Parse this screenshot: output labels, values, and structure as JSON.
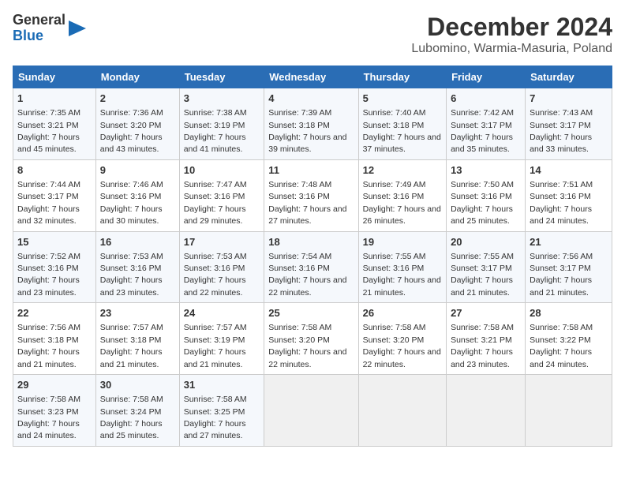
{
  "logo": {
    "line1": "General",
    "line2": "Blue"
  },
  "title": "December 2024",
  "subtitle": "Lubomino, Warmia-Masuria, Poland",
  "days_of_week": [
    "Sunday",
    "Monday",
    "Tuesday",
    "Wednesday",
    "Thursday",
    "Friday",
    "Saturday"
  ],
  "weeks": [
    [
      {
        "day": 1,
        "sunrise": "7:35 AM",
        "sunset": "3:21 PM",
        "daylight": "7 hours and 45 minutes."
      },
      {
        "day": 2,
        "sunrise": "7:36 AM",
        "sunset": "3:20 PM",
        "daylight": "7 hours and 43 minutes."
      },
      {
        "day": 3,
        "sunrise": "7:38 AM",
        "sunset": "3:19 PM",
        "daylight": "7 hours and 41 minutes."
      },
      {
        "day": 4,
        "sunrise": "7:39 AM",
        "sunset": "3:18 PM",
        "daylight": "7 hours and 39 minutes."
      },
      {
        "day": 5,
        "sunrise": "7:40 AM",
        "sunset": "3:18 PM",
        "daylight": "7 hours and 37 minutes."
      },
      {
        "day": 6,
        "sunrise": "7:42 AM",
        "sunset": "3:17 PM",
        "daylight": "7 hours and 35 minutes."
      },
      {
        "day": 7,
        "sunrise": "7:43 AM",
        "sunset": "3:17 PM",
        "daylight": "7 hours and 33 minutes."
      }
    ],
    [
      {
        "day": 8,
        "sunrise": "7:44 AM",
        "sunset": "3:17 PM",
        "daylight": "7 hours and 32 minutes."
      },
      {
        "day": 9,
        "sunrise": "7:46 AM",
        "sunset": "3:16 PM",
        "daylight": "7 hours and 30 minutes."
      },
      {
        "day": 10,
        "sunrise": "7:47 AM",
        "sunset": "3:16 PM",
        "daylight": "7 hours and 29 minutes."
      },
      {
        "day": 11,
        "sunrise": "7:48 AM",
        "sunset": "3:16 PM",
        "daylight": "7 hours and 27 minutes."
      },
      {
        "day": 12,
        "sunrise": "7:49 AM",
        "sunset": "3:16 PM",
        "daylight": "7 hours and 26 minutes."
      },
      {
        "day": 13,
        "sunrise": "7:50 AM",
        "sunset": "3:16 PM",
        "daylight": "7 hours and 25 minutes."
      },
      {
        "day": 14,
        "sunrise": "7:51 AM",
        "sunset": "3:16 PM",
        "daylight": "7 hours and 24 minutes."
      }
    ],
    [
      {
        "day": 15,
        "sunrise": "7:52 AM",
        "sunset": "3:16 PM",
        "daylight": "7 hours and 23 minutes."
      },
      {
        "day": 16,
        "sunrise": "7:53 AM",
        "sunset": "3:16 PM",
        "daylight": "7 hours and 23 minutes."
      },
      {
        "day": 17,
        "sunrise": "7:53 AM",
        "sunset": "3:16 PM",
        "daylight": "7 hours and 22 minutes."
      },
      {
        "day": 18,
        "sunrise": "7:54 AM",
        "sunset": "3:16 PM",
        "daylight": "7 hours and 22 minutes."
      },
      {
        "day": 19,
        "sunrise": "7:55 AM",
        "sunset": "3:16 PM",
        "daylight": "7 hours and 21 minutes."
      },
      {
        "day": 20,
        "sunrise": "7:55 AM",
        "sunset": "3:17 PM",
        "daylight": "7 hours and 21 minutes."
      },
      {
        "day": 21,
        "sunrise": "7:56 AM",
        "sunset": "3:17 PM",
        "daylight": "7 hours and 21 minutes."
      }
    ],
    [
      {
        "day": 22,
        "sunrise": "7:56 AM",
        "sunset": "3:18 PM",
        "daylight": "7 hours and 21 minutes."
      },
      {
        "day": 23,
        "sunrise": "7:57 AM",
        "sunset": "3:18 PM",
        "daylight": "7 hours and 21 minutes."
      },
      {
        "day": 24,
        "sunrise": "7:57 AM",
        "sunset": "3:19 PM",
        "daylight": "7 hours and 21 minutes."
      },
      {
        "day": 25,
        "sunrise": "7:58 AM",
        "sunset": "3:20 PM",
        "daylight": "7 hours and 22 minutes."
      },
      {
        "day": 26,
        "sunrise": "7:58 AM",
        "sunset": "3:20 PM",
        "daylight": "7 hours and 22 minutes."
      },
      {
        "day": 27,
        "sunrise": "7:58 AM",
        "sunset": "3:21 PM",
        "daylight": "7 hours and 23 minutes."
      },
      {
        "day": 28,
        "sunrise": "7:58 AM",
        "sunset": "3:22 PM",
        "daylight": "7 hours and 24 minutes."
      }
    ],
    [
      {
        "day": 29,
        "sunrise": "7:58 AM",
        "sunset": "3:23 PM",
        "daylight": "7 hours and 24 minutes."
      },
      {
        "day": 30,
        "sunrise": "7:58 AM",
        "sunset": "3:24 PM",
        "daylight": "7 hours and 25 minutes."
      },
      {
        "day": 31,
        "sunrise": "7:58 AM",
        "sunset": "3:25 PM",
        "daylight": "7 hours and 27 minutes."
      },
      null,
      null,
      null,
      null
    ]
  ],
  "labels": {
    "sunrise": "Sunrise:",
    "sunset": "Sunset:",
    "daylight": "Daylight:"
  }
}
